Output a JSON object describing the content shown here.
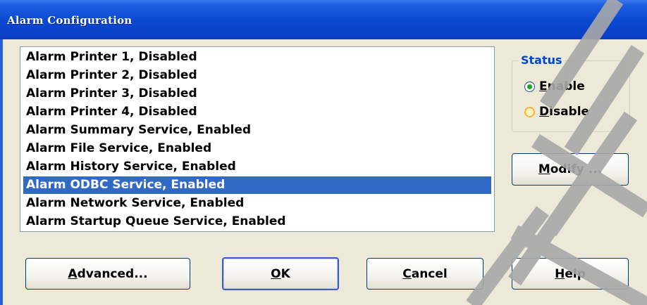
{
  "window": {
    "title": "Alarm Configuration"
  },
  "list": {
    "items": [
      "Alarm Printer 1, Disabled",
      "Alarm Printer 2, Disabled",
      "Alarm Printer 3, Disabled",
      "Alarm Printer 4, Disabled",
      "Alarm Summary Service, Enabled",
      "Alarm File Service, Enabled",
      "Alarm History Service, Enabled",
      "Alarm ODBC Service, Enabled",
      "Alarm Network Service, Enabled",
      "Alarm Startup Queue Service, Enabled"
    ],
    "selected_index": 7
  },
  "status": {
    "label": "Status",
    "enable": {
      "mnemonic": "E",
      "rest": "nable",
      "checked": true
    },
    "disable": {
      "mnemonic": "D",
      "rest": "isable",
      "checked": false
    }
  },
  "buttons": {
    "modify": {
      "mnemonic": "M",
      "rest": "odify ..."
    },
    "advanced": {
      "mnemonic": "A",
      "rest": "dvanced..."
    },
    "ok": {
      "mnemonic": "O",
      "rest": "K"
    },
    "cancel": {
      "mnemonic": "C",
      "rest": "ancel"
    },
    "help": {
      "mnemonic": "H",
      "rest": "elp"
    }
  },
  "colors": {
    "titlebar": "#0a47d1",
    "selection": "#316ac5",
    "dialog_bg": "#ece9d8",
    "group_label": "#0046d5"
  }
}
